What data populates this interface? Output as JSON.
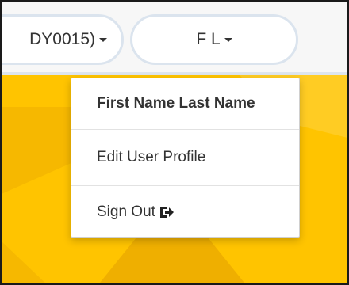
{
  "header": {
    "account_label": "DY0015)",
    "user_initials": "F L"
  },
  "dropdown": {
    "user_full_name": "First Name Last Name",
    "edit_profile_label": "Edit User Profile",
    "sign_out_label": "Sign Out"
  },
  "icons": {
    "caret": "chevron-down-icon",
    "sign_out": "sign-out-icon"
  },
  "colors": {
    "accent_yellow": "#ffc400",
    "pill_border": "#dbe4ee",
    "text": "#333333"
  }
}
